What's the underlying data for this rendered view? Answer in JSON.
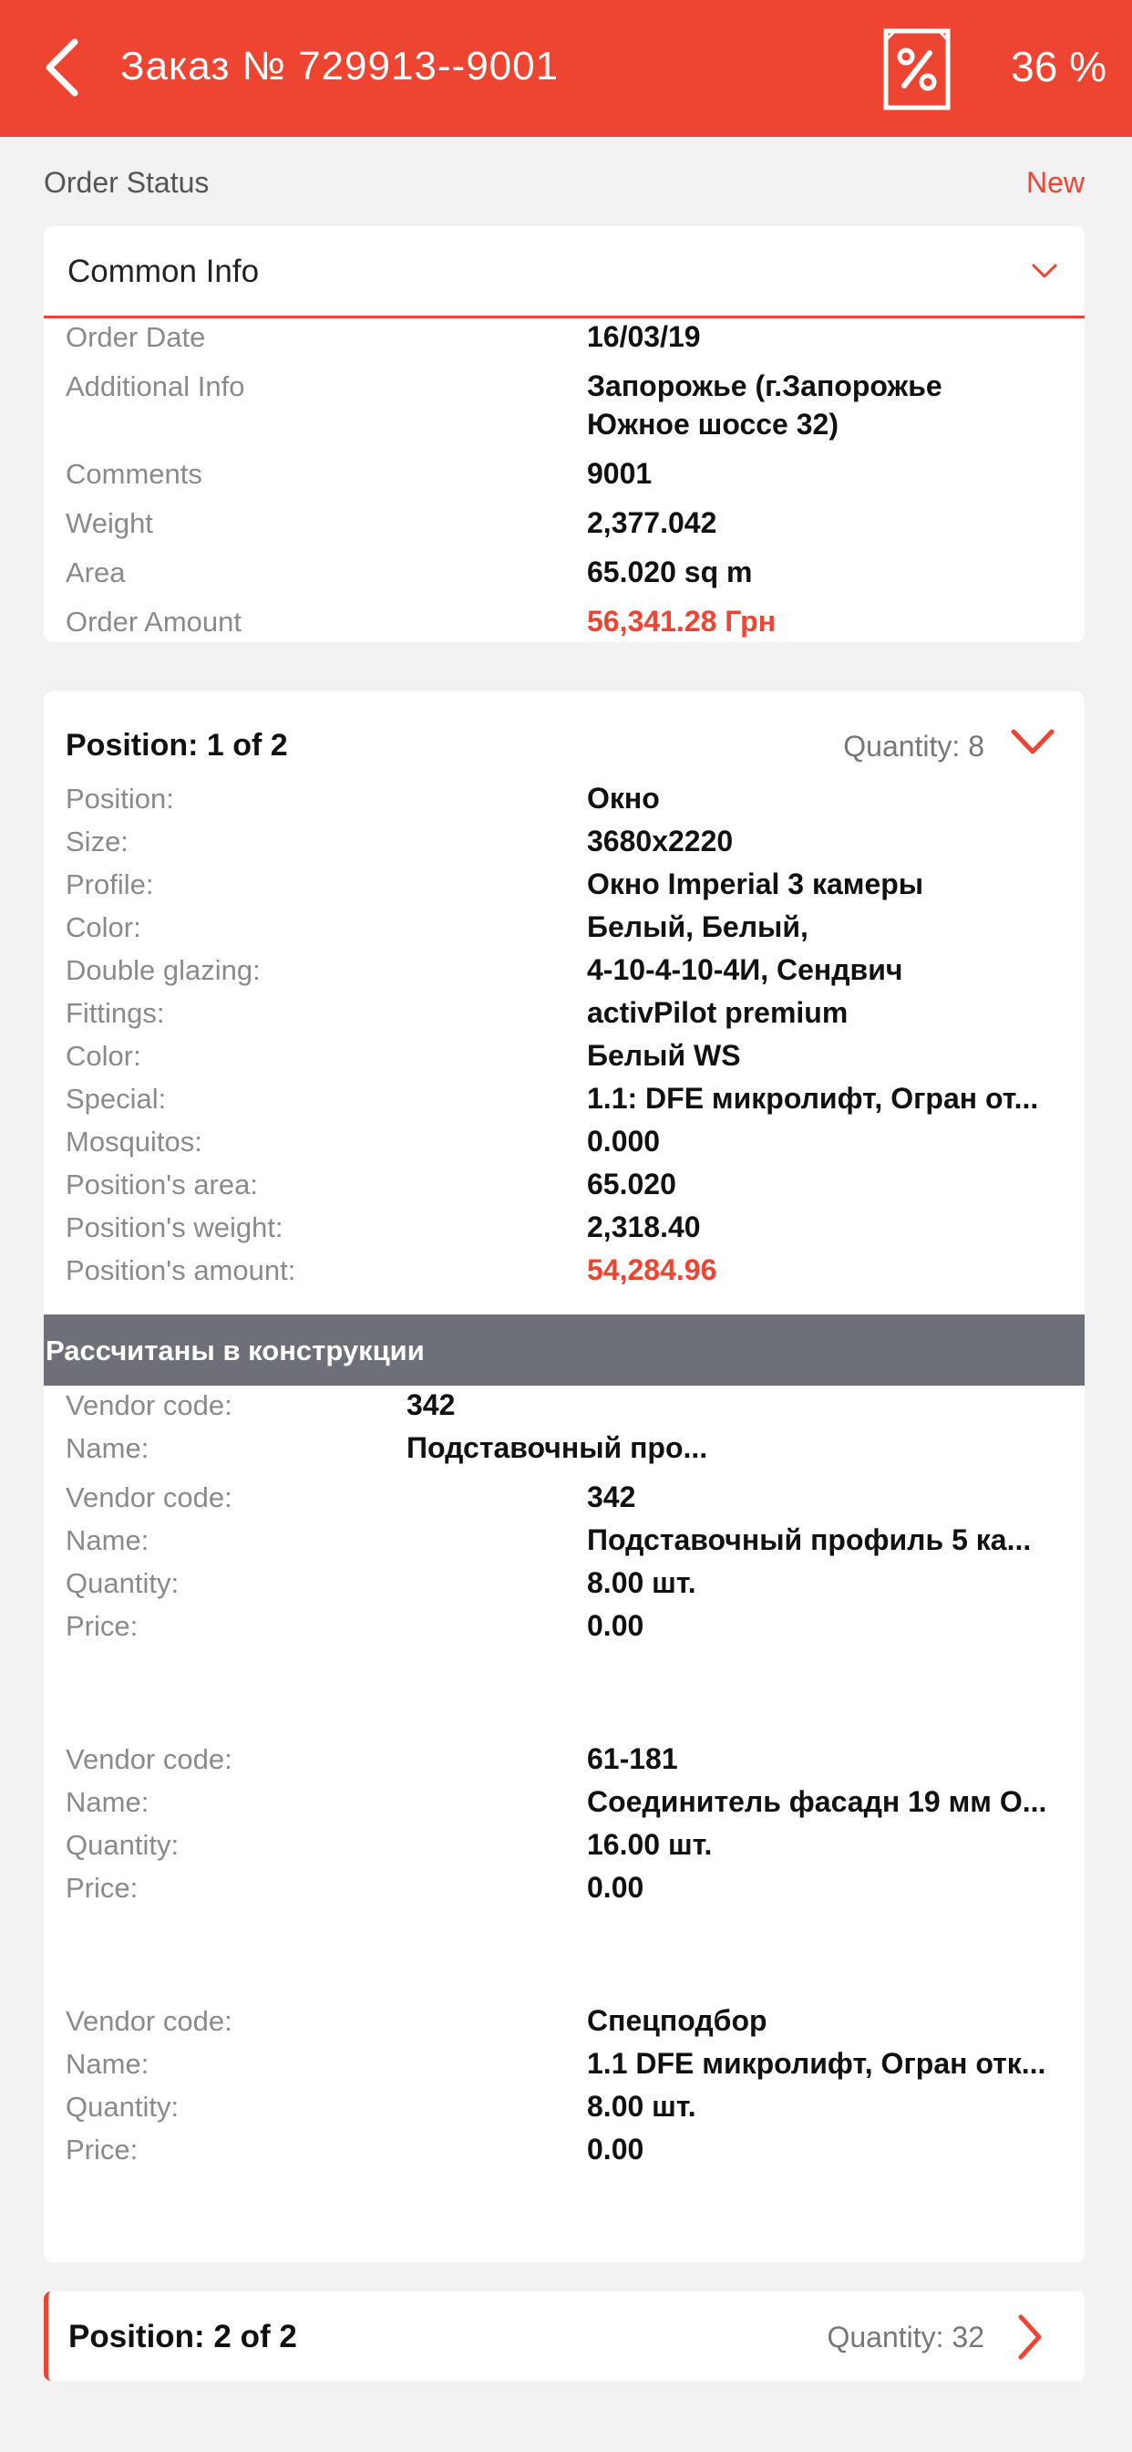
{
  "header": {
    "title": "Заказ № 729913--9001",
    "percent": "36 %",
    "back_icon": "chevron-left-icon",
    "discount_icon": "percent-receipt-icon",
    "accent_color": "#ee4432"
  },
  "status": {
    "label": "Order Status",
    "value": "New"
  },
  "common_info": {
    "title": "Common Info",
    "rows": [
      {
        "label": "Order Date",
        "value": "16/03/19"
      },
      {
        "label": "Additional Info",
        "value": "Запорожье (г.Запорожье",
        "value2": "Южное шоссе 32)"
      },
      {
        "label": "Comments",
        "value": "9001"
      },
      {
        "label": "Weight",
        "value": "2,377.042"
      },
      {
        "label": "Area",
        "value": "65.020 sq m"
      },
      {
        "label": "Order Amount",
        "value": "56,341.28 Грн"
      }
    ]
  },
  "position1": {
    "title": "Position: 1 of 2",
    "quantity": "Quantity: 8",
    "rows": [
      {
        "label": "Position:",
        "value": "Окно"
      },
      {
        "label": "Size:",
        "value": "3680x2220"
      },
      {
        "label": "Profile:",
        "value": "Окно Imperial 3 камеры"
      },
      {
        "label": "Color:",
        "value": "Белый, Белый,"
      },
      {
        "label": "Double glazing:",
        "value": "4-10-4-10-4И, Сендвич"
      },
      {
        "label": "Fittings:",
        "value": "activPilot premium"
      },
      {
        "label": "Color:",
        "value": "Белый WS"
      },
      {
        "label": "Special:",
        "value": "1.1: DFE микролифт, Огран от..."
      },
      {
        "label": "Mosquitos:",
        "value": "0.000"
      },
      {
        "label": "Position's area:",
        "value": "65.020"
      },
      {
        "label": "Position's weight:",
        "value": "2,318.40"
      },
      {
        "label": "Position's amount:",
        "value": "54,284.96"
      }
    ],
    "section_title": "Рассчитаны в конструкции",
    "summary": {
      "vendor_label": "Vendor code:",
      "vendor_value": "342",
      "name_label": "Name:",
      "name_value": "Подставочный про..."
    },
    "items": [
      {
        "vendor_label": "Vendor code:",
        "vendor": "342",
        "name_label": "Name:",
        "name": "Подставочный профиль 5 ка...",
        "qty_label": "Quantity:",
        "qty": "8.00 шт.",
        "price_label": "Price:",
        "price": "0.00"
      },
      {
        "vendor_label": "Vendor code:",
        "vendor": "61-181",
        "name_label": "Name:",
        "name": "Соединитель фасадн 19 мм О...",
        "qty_label": "Quantity:",
        "qty": "16.00 шт.",
        "price_label": "Price:",
        "price": "0.00"
      },
      {
        "vendor_label": "Vendor code:",
        "vendor": "Спецподбор",
        "name_label": "Name:",
        "name": "1.1 DFE микролифт, Огран отк...",
        "qty_label": "Quantity:",
        "qty": "8.00 шт.",
        "price_label": "Price:",
        "price": "0.00"
      }
    ]
  },
  "position2": {
    "title": "Position: 2 of 2",
    "quantity": "Quantity: 32"
  }
}
